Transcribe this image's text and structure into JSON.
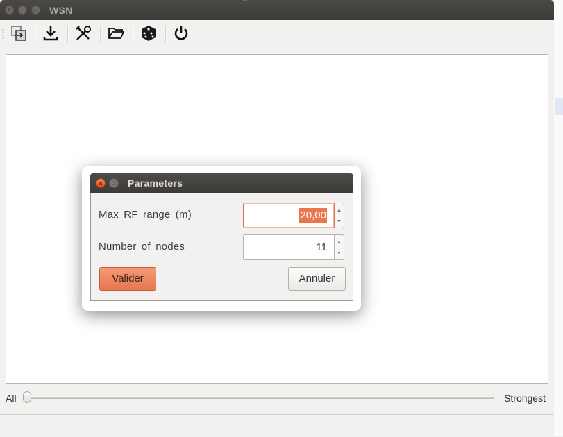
{
  "window": {
    "title": "WSN"
  },
  "toolbar": {
    "buttons": [
      {
        "icon": "export-icon"
      },
      {
        "icon": "download-icon"
      },
      {
        "icon": "tools-icon"
      },
      {
        "icon": "open-folder-icon"
      },
      {
        "icon": "dice-icon"
      },
      {
        "icon": "power-icon"
      }
    ]
  },
  "slider": {
    "left_label": "All",
    "right_label": "Strongest",
    "value_fraction": 0.0
  },
  "dialog": {
    "title": "Parameters",
    "fields": [
      {
        "label": "Max RF range (m)",
        "value": "20,00",
        "selected": true
      },
      {
        "label": "Number of nodes",
        "value": "11",
        "selected": false
      }
    ],
    "ok_label": "Valider",
    "cancel_label": "Annuler"
  },
  "colors": {
    "accent": "#e9764f",
    "titlebar": "#3c3b37"
  }
}
